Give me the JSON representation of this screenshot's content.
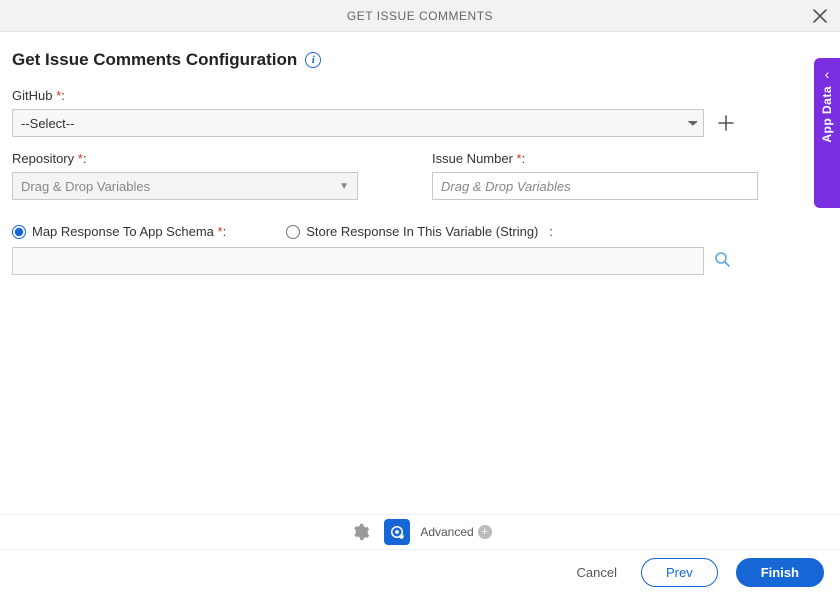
{
  "titlebar": {
    "title": "GET ISSUE COMMENTS"
  },
  "heading": "Get Issue Comments Configuration",
  "github": {
    "label": "GitHub",
    "selected": "--Select--"
  },
  "repository": {
    "label": "Repository",
    "placeholder": "Drag & Drop Variables"
  },
  "issue_number": {
    "label": "Issue Number",
    "placeholder": "Drag & Drop Variables"
  },
  "response": {
    "map_label": "Map Response To App Schema",
    "store_label": "Store Response In This Variable (String)",
    "selected": "map"
  },
  "side_panel": {
    "label": "App Data"
  },
  "toolbar": {
    "advanced_label": "Advanced"
  },
  "footer": {
    "cancel": "Cancel",
    "prev": "Prev",
    "finish": "Finish"
  }
}
